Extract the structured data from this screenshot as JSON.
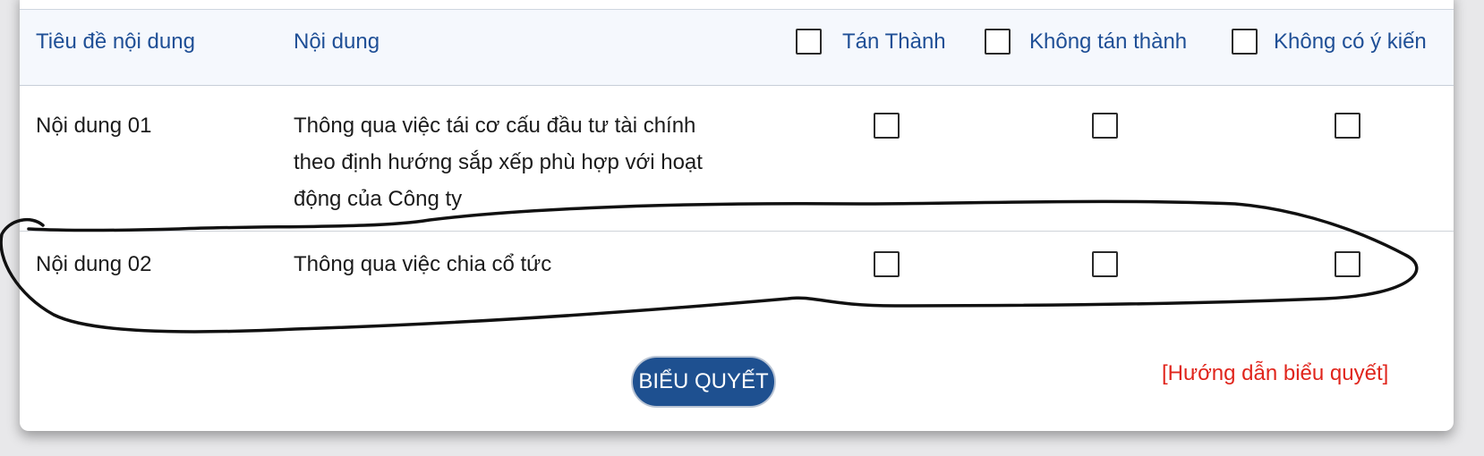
{
  "table": {
    "columns": {
      "title": "Tiêu đề nội dung",
      "content": "Nội dung",
      "approve": "Tán Thành",
      "disapprove": "Không tán thành",
      "no_opinion": "Không có ý kiến"
    },
    "rows": [
      {
        "title": "Nội dung 01",
        "content_lines": [
          "Thông qua việc tái cơ cấu đầu tư tài chính",
          "theo định hướng sắp xếp phù hợp với hoạt",
          "động của Công ty"
        ]
      },
      {
        "title": "Nội dung 02",
        "content_lines": [
          "Thông qua việc chia cổ tức"
        ]
      }
    ]
  },
  "actions": {
    "vote_button": "BIỂU QUYẾT",
    "guide_link": "[Hướng dẫn biểu quyết]"
  },
  "colors": {
    "header_text": "#1f4f96",
    "header_bg": "#f5f8fd",
    "button_bg": "#1e5090",
    "link_red": "#e0251c",
    "annotation_stroke": "#111111"
  }
}
